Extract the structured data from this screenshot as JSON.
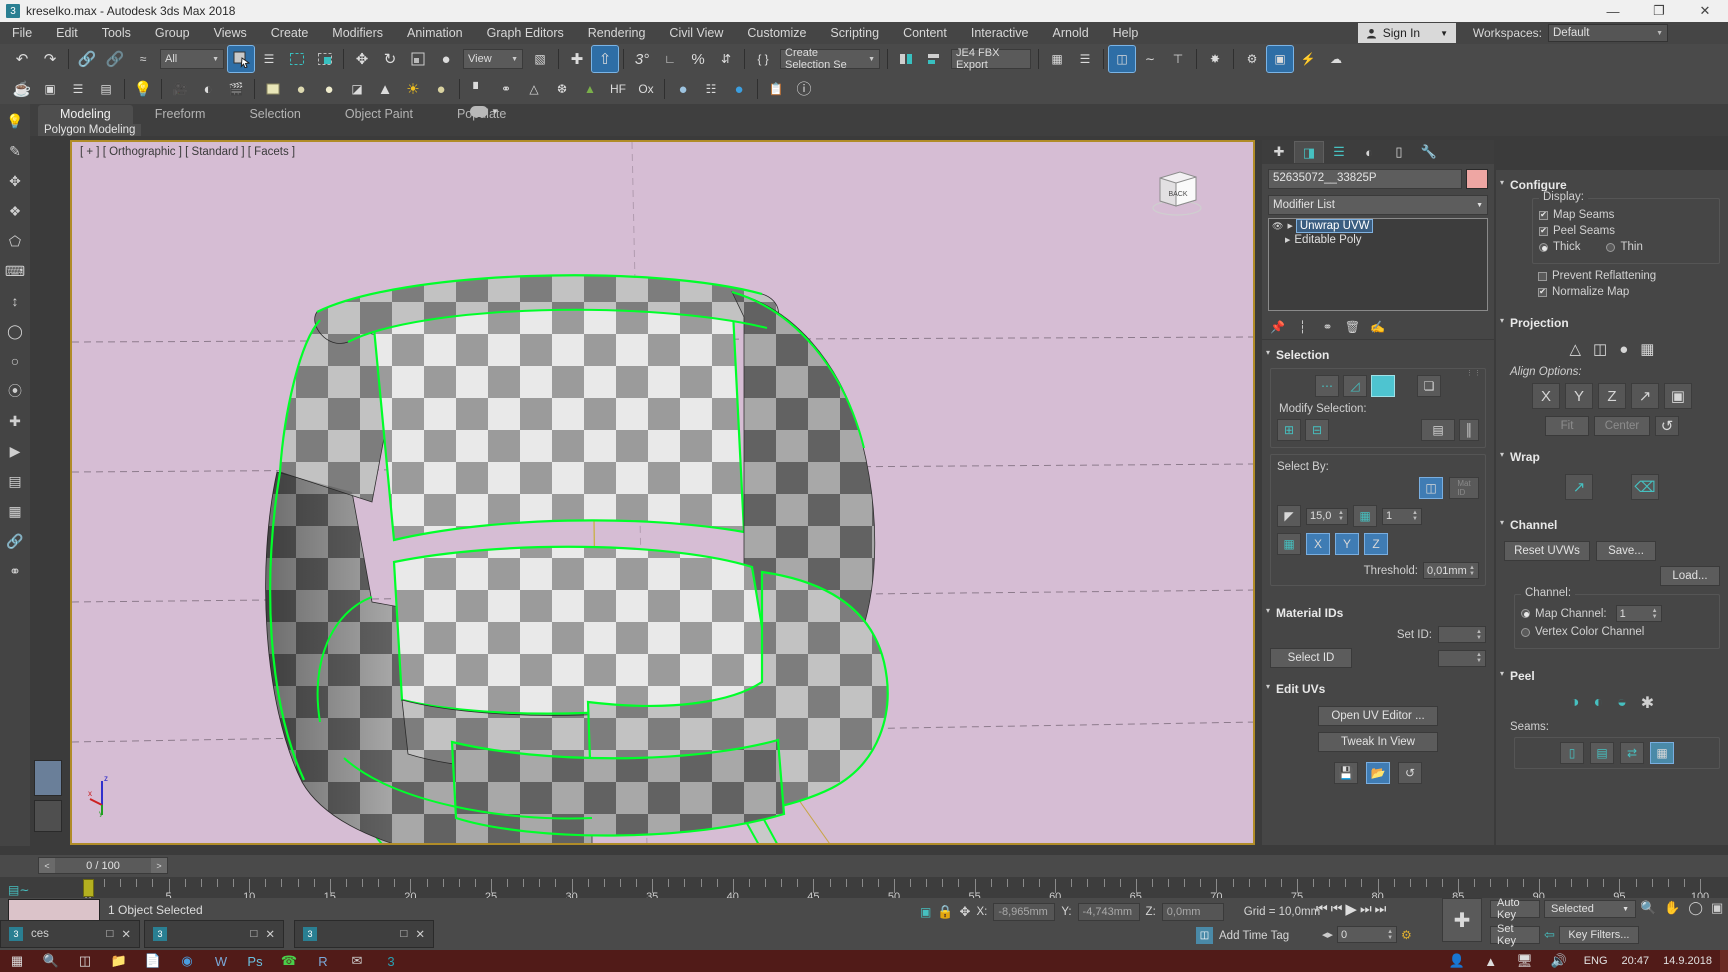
{
  "window": {
    "title": "kreselko.max - Autodesk 3ds Max 2018",
    "app_icon": "max-logo-icon",
    "minimize": "—",
    "maximize": "❐",
    "close": "✕"
  },
  "menubar": {
    "items": [
      "File",
      "Edit",
      "Tools",
      "Group",
      "Views",
      "Create",
      "Modifiers",
      "Animation",
      "Graph Editors",
      "Rendering",
      "Civil View",
      "Customize",
      "Scripting",
      "Content",
      "Interactive",
      "Arnold",
      "Help"
    ],
    "sign_in": "Sign In",
    "workspaces_label": "Workspaces:",
    "workspaces_value": "Default"
  },
  "toolbar": {
    "selection_filter": "All",
    "reference_coord": "View",
    "named_selection_sets": "Create Selection Se",
    "fbx_export_preset": "JE4 FBX Export",
    "row1_icons": [
      "undo-icon",
      "redo-icon",
      "select-and-link-icon",
      "unlink-selection-icon",
      "bind-to-space-warp-icon",
      "select-object-icon",
      "select-by-name-icon",
      "rectangular-selection-region-icon",
      "window-crossing-icon",
      "select-and-move-icon",
      "select-and-rotate-icon",
      "select-and-scale-icon",
      "select-and-place-icon",
      "use-center-flyout-icon",
      "select-and-manipulate-icon",
      "snaps-toggle-icon",
      "angle-snap-toggle-icon",
      "percent-snap-toggle-icon",
      "spinner-snap-toggle-icon",
      "edit-named-selection-sets-icon",
      "mirror-icon",
      "align-icon",
      "layer-explorer-icon",
      "curve-editor-icon",
      "schematic-view-icon",
      "material-editor-icon",
      "render-setup-icon",
      "render-frame-window-icon",
      "render-production-icon"
    ],
    "row2_icons": [
      "teapot-icon",
      "render-preview-icon",
      "scene-explorer-icon",
      "layer-manager-icon",
      "light-icon",
      "camera-icon",
      "shading-icon",
      "render-icon",
      "box-icon",
      "sphere-icon",
      "geosphere-icon",
      "cylinder-icon",
      "cone-icon",
      "sun-icon",
      "torus-icon",
      "particles-icon",
      "atom-icon",
      "pyramid-icon",
      "noise-icon",
      "grass-icon",
      "hair-icon",
      "ox-icon",
      "material-ball-icon",
      "asset-tracking-icon",
      "scene-converter-icon",
      "render-message-icon",
      "help-icon"
    ]
  },
  "ribbon": {
    "tabs": [
      "Modeling",
      "Freeform",
      "Selection",
      "Object Paint",
      "Populate"
    ],
    "selected_tab": "Modeling",
    "subtab": "Polygon Modeling"
  },
  "viewport": {
    "label": "[ + ] [ Orthographic ] [ Standard ] [ Facets ]",
    "background_color": "#d6bdd4",
    "border_color": "#b08c28",
    "viewcube_face": "BACK",
    "axis_x": "x",
    "axis_y": "y",
    "axis_z": "z"
  },
  "command_panel": {
    "tabs": [
      "create-tab-icon",
      "modify-tab-icon",
      "hierarchy-tab-icon",
      "motion-tab-icon",
      "display-tab-icon",
      "utilities-tab-icon"
    ],
    "selected_tab_index": 1,
    "object_name": "52635072__33825P",
    "object_color": "#eea6a3",
    "modifier_list_label": "Modifier List",
    "stack": [
      {
        "name": "Unwrap UVW",
        "selected": true,
        "eye": true
      },
      {
        "name": "Editable Poly",
        "selected": false,
        "eye": false
      }
    ],
    "stack_buttons": [
      "pin-stack-icon",
      "show-end-result-icon",
      "make-unique-icon",
      "remove-modifier-icon",
      "configure-modifier-sets-icon"
    ],
    "rollouts": {
      "selection": {
        "title": "Selection",
        "sub_object_icons": [
          "vertex-select-icon",
          "edge-select-icon",
          "face-select-icon",
          "element-select-icon"
        ],
        "modify_selection_label": "Modify Selection:",
        "modify_icons": [
          "grow-selection-icon",
          "shrink-selection-icon",
          "loop-uv-icon",
          "ring-uv-icon"
        ],
        "select_by_label": "Select By:",
        "select_by_icons": [
          "select-by-element-icon",
          "select-by-material-id-icon"
        ],
        "planar_angle_value": "15,0",
        "map_channel_value": "1",
        "axis_icons": [
          "select-by-smoothing-icon"
        ],
        "axis_x": "X",
        "axis_y": "Y",
        "axis_z": "Z",
        "threshold_label": "Threshold:",
        "threshold_value": "0,01mm"
      },
      "material_ids": {
        "title": "Material IDs",
        "set_id_label": "Set ID:",
        "set_id_value": "",
        "select_id_label": "Select ID",
        "select_id_value": ""
      },
      "edit_uvs": {
        "title": "Edit UVs",
        "open_uv_editor": "Open UV Editor ...",
        "tweak_in_view": "Tweak In View",
        "footer_icons": [
          "save-uvs-icon",
          "load-uvs-icon",
          "reset-uvs-icon"
        ]
      }
    }
  },
  "right_panel": {
    "configure": {
      "title": "Configure",
      "display_label": "Display:",
      "map_seams_label": "Map Seams",
      "map_seams_checked": true,
      "peel_seams_label": "Peel Seams",
      "peel_seams_checked": true,
      "thick_label": "Thick",
      "thin_label": "Thin",
      "thickness_selected": "Thick",
      "prevent_reflattening_label": "Prevent Reflattening",
      "prevent_reflattening_checked": false,
      "normalize_map_label": "Normalize Map",
      "normalize_map_checked": true
    },
    "projection": {
      "title": "Projection",
      "mode_icons": [
        "planar-map-icon",
        "cylindrical-map-icon",
        "spherical-map-icon",
        "box-map-icon"
      ],
      "align_options_label": "Align Options:",
      "align_x": "X",
      "align_y": "Y",
      "align_z": "Z",
      "align_extra_icons": [
        "align-to-view-icon",
        "best-align-icon"
      ],
      "fit_label": "Fit",
      "center_label": "Center",
      "reset_icon": "reset-projection-icon"
    },
    "wrap": {
      "title": "Wrap",
      "icons": [
        "wrap-stitch-icon",
        "wrap-unfold-icon"
      ]
    },
    "channel": {
      "title": "Channel",
      "reset_uvws_label": "Reset UVWs",
      "save_label": "Save...",
      "load_label": "Load...",
      "channel_label": "Channel:",
      "map_channel_label": "Map Channel:",
      "map_channel_value": "1",
      "map_channel_selected": true,
      "vertex_color_channel_label": "Vertex Color Channel",
      "vertex_color_selected": false
    },
    "peel": {
      "title": "Peel",
      "icons": [
        "quick-peel-icon",
        "pelt-map-icon",
        "peel-mode-icon",
        "relax-icon"
      ],
      "seams_label": "Seams:",
      "seam_icons": [
        "edge-sel-to-seams-icon",
        "expand-to-seams-icon",
        "point-to-point-seam-icon",
        "edit-seams-icon"
      ]
    }
  },
  "timeline": {
    "frame_display": "0 / 100",
    "prev_arrow": "<",
    "next_arrow": ">",
    "ticks": [
      0,
      5,
      10,
      15,
      20,
      25,
      30,
      35,
      40,
      45,
      50,
      55,
      60,
      65,
      70,
      75,
      80,
      85,
      90,
      95,
      100
    ],
    "current_frame": 0
  },
  "status": {
    "selection_text": "1 Object Selected",
    "x_label": "X:",
    "x_value": "-8,965mm",
    "y_label": "Y:",
    "y_value": "-4,743mm",
    "z_label": "Z:",
    "z_value": "0,0mm",
    "grid_text": "Grid = 10,0mm",
    "add_time_tag": "Add Time Tag",
    "auto_key": "Auto Key",
    "set_key": "Set Key",
    "selected_dropdown": "Selected",
    "key_filters": "Key Filters...",
    "key_frame_value": "0",
    "lock_icon": "lock-selection-icon",
    "snap_icon": "absolute-relative-transform-icon"
  },
  "taskbar": {
    "windows": [
      {
        "icon": "3dsmax-doc-icon",
        "label": "ces"
      },
      {
        "icon": "3dsmax-doc-icon",
        "label": ""
      },
      {
        "icon": "3dsmax-doc-icon",
        "label": ""
      }
    ],
    "tray_icons": [
      "people-icon",
      "chevron-up-icon",
      "network-icon",
      "volume-icon"
    ],
    "language": "ENG",
    "time": "20:47",
    "date": "14.9.2018",
    "app_icons": [
      "start-icon",
      "search-icon",
      "task-view-icon",
      "explorer-icon",
      "folder-icon",
      "chrome-icon",
      "word-icon",
      "photoshop-icon",
      "whatsapp-icon",
      "r-icon",
      "mail-icon",
      "max-icon"
    ]
  }
}
